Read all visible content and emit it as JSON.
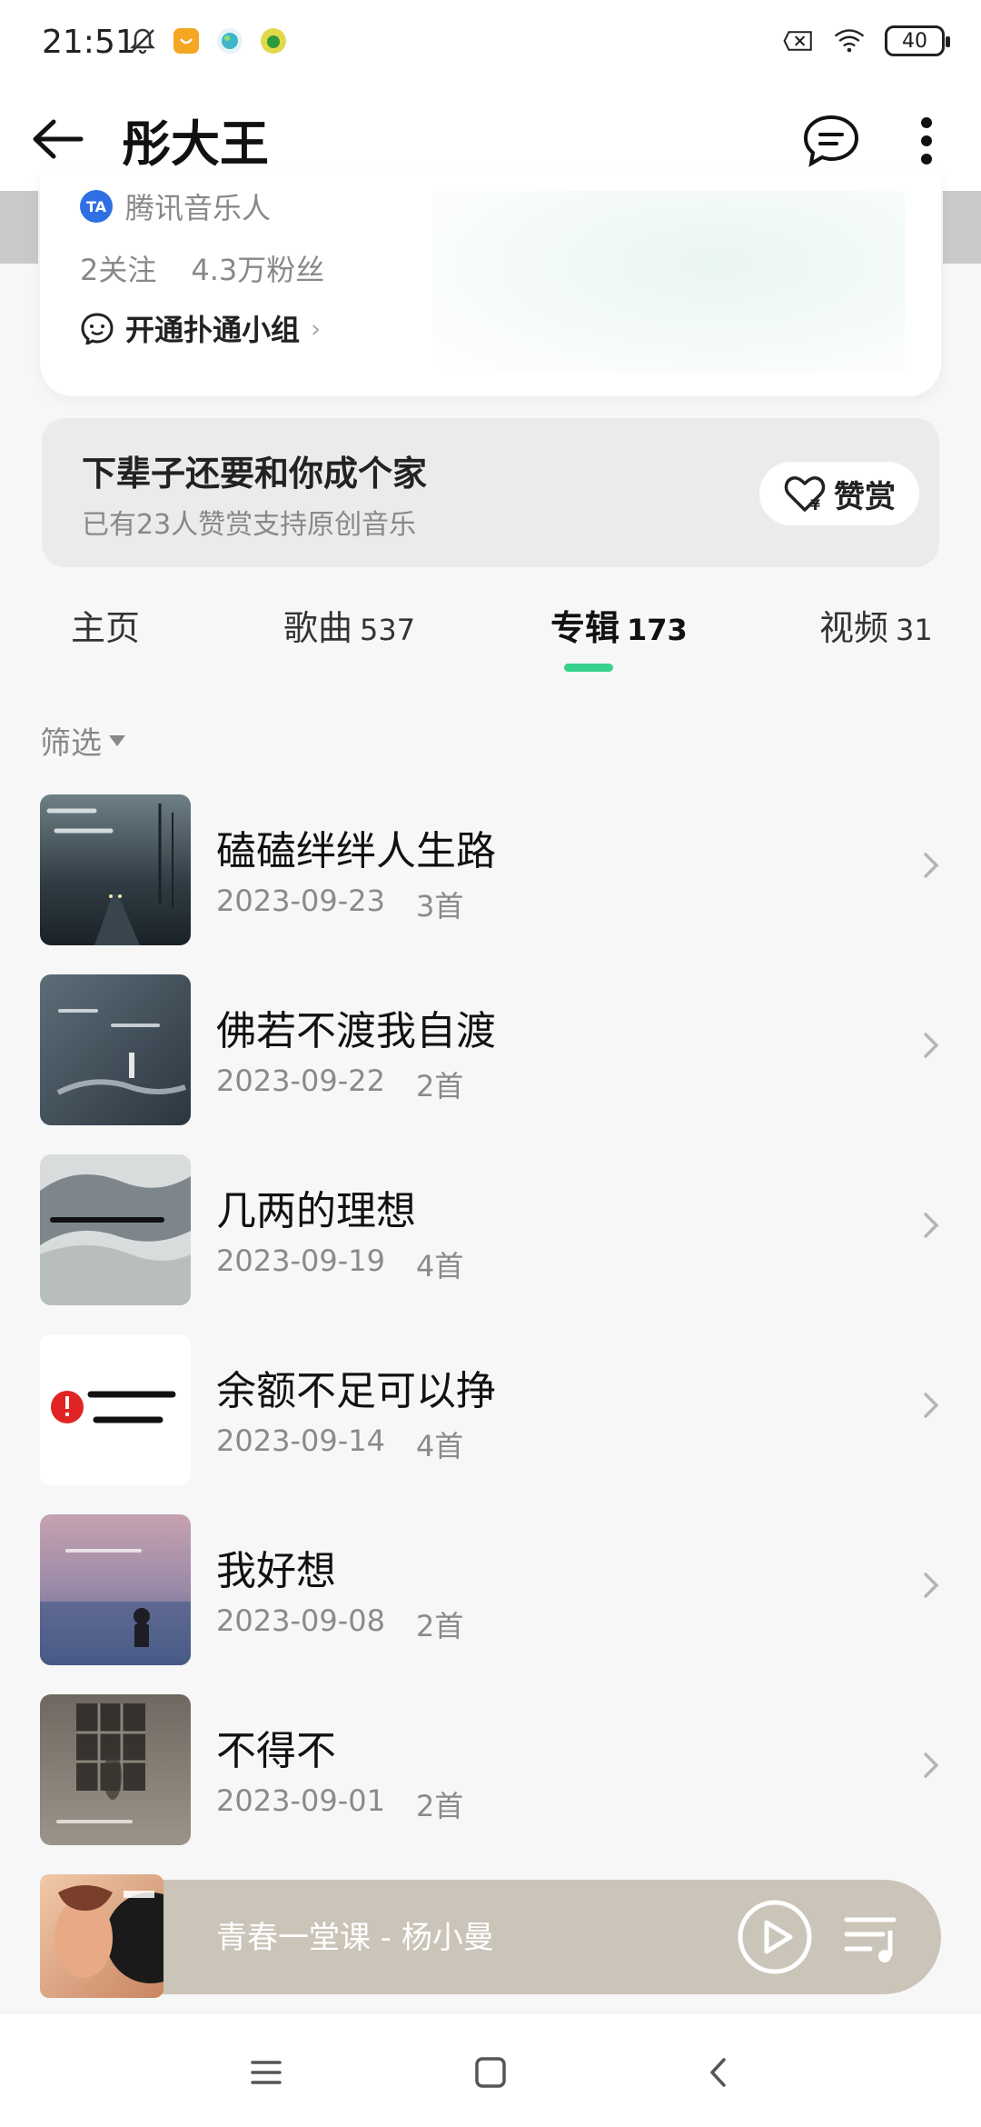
{
  "status_bar": {
    "time": "21:51",
    "battery": "40",
    "icons": [
      "mute-bell-icon",
      "app-notification-icon",
      "earth-icon",
      "lemon-icon",
      "no-sim-icon",
      "wifi-icon",
      "battery-icon"
    ]
  },
  "header": {
    "title": "彤大王",
    "icons": [
      "back-arrow-icon",
      "message-bubble-icon",
      "more-vertical-icon"
    ]
  },
  "profile": {
    "verify_label": "腾讯音乐人",
    "follows": "2关注",
    "fans": "4.3万粉丝",
    "group_label": "开通扑通小组"
  },
  "tip": {
    "title": "下辈子还要和你成个家",
    "subtitle": "已有23人赞赏支持原创音乐",
    "button_label": "赞赏"
  },
  "tabs": [
    {
      "label": "主页",
      "count": ""
    },
    {
      "label": "歌曲",
      "count": "537"
    },
    {
      "label": "专辑",
      "count": "173"
    },
    {
      "label": "视频",
      "count": "31"
    }
  ],
  "active_tab": "专辑",
  "filter": {
    "label": "筛选"
  },
  "albums": [
    {
      "title": "磕磕绊绊人生路",
      "date": "2023-09-23",
      "tracks": "3首"
    },
    {
      "title": "佛若不渡我自渡",
      "date": "2023-09-22",
      "tracks": "2首"
    },
    {
      "title": "几两的理想",
      "date": "2023-09-19",
      "tracks": "4首"
    },
    {
      "title": "余额不足可以挣",
      "date": "2023-09-14",
      "tracks": "4首"
    },
    {
      "title": "我好想",
      "date": "2023-09-08",
      "tracks": "2首"
    },
    {
      "title": "不得不",
      "date": "2023-09-01",
      "tracks": "2首"
    }
  ],
  "player": {
    "now_playing": "青春一堂课 - 杨小曼"
  },
  "colors": {
    "accent": "#36d28c",
    "player_bg": "#cbc4b8",
    "verify_blue": "#2f6fe4"
  }
}
